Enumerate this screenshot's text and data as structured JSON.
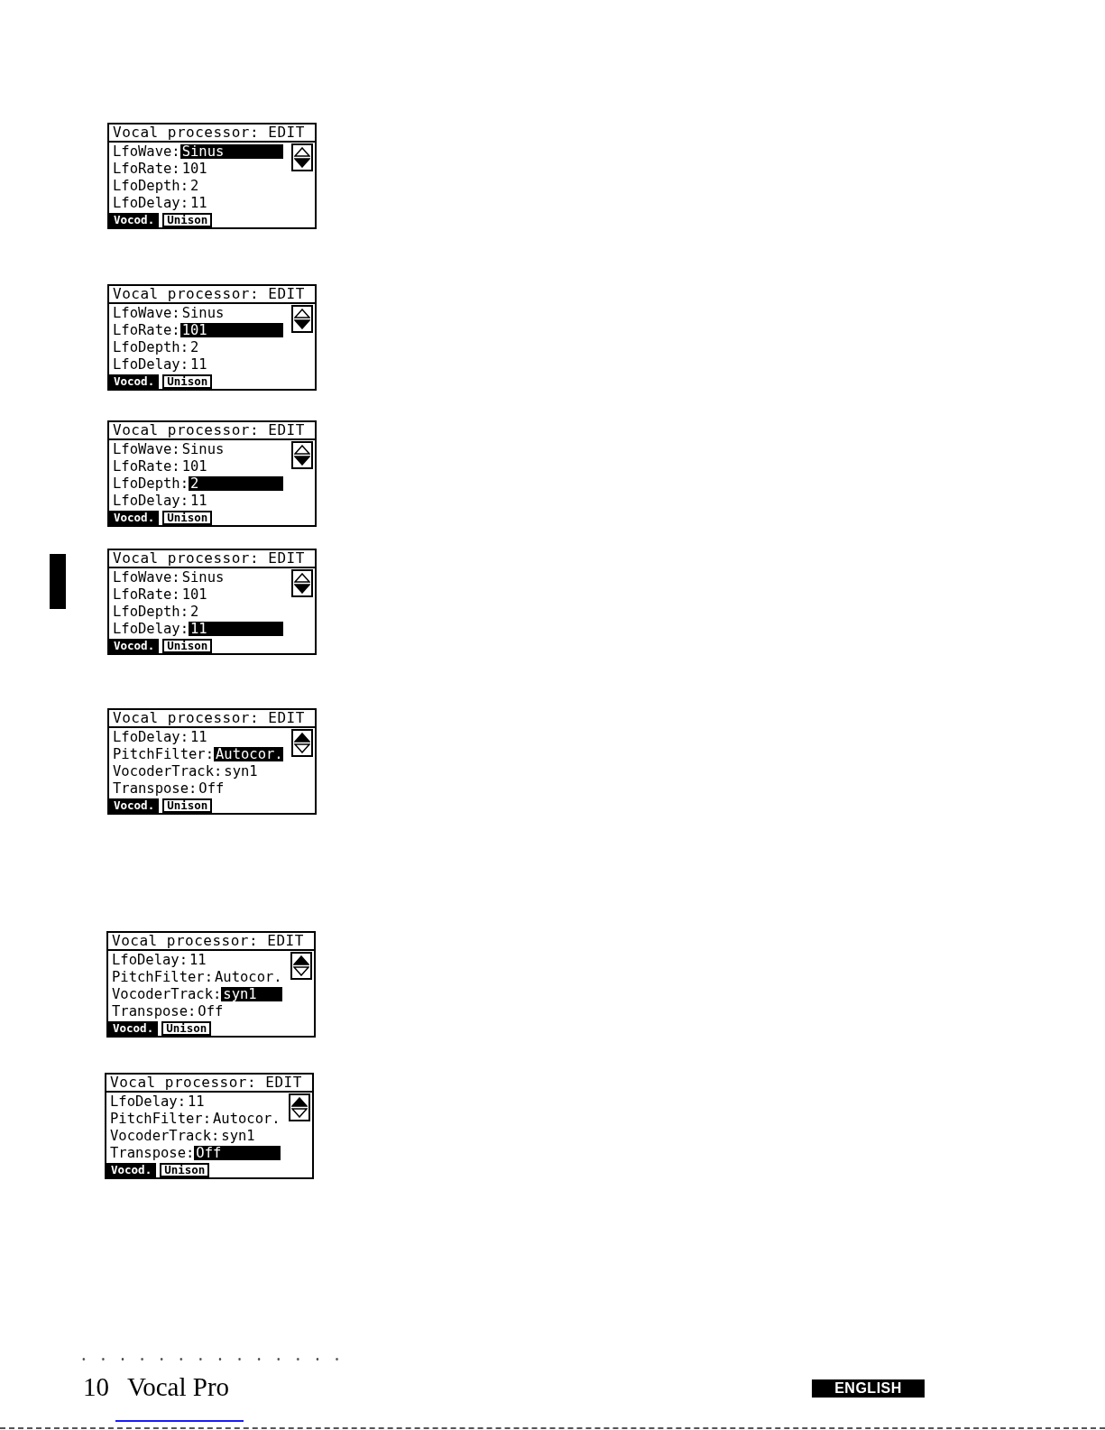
{
  "screens": [
    {
      "title": "Vocal processor: EDIT",
      "rows": [
        {
          "label": "LfoWave:",
          "value": "Sinus",
          "selected": true
        },
        {
          "label": "LfoRate:",
          "value": "101",
          "selected": false
        },
        {
          "label": "LfoDepth:",
          "value": "2",
          "selected": false
        },
        {
          "label": "LfoDelay:",
          "value": "11",
          "selected": false
        }
      ],
      "more_above": false,
      "more_below": true,
      "tabs": [
        {
          "label": "Vocod.",
          "selected": true
        },
        {
          "label": "Unison",
          "selected": false
        }
      ]
    },
    {
      "title": "Vocal processor: EDIT",
      "rows": [
        {
          "label": "LfoWave:",
          "value": "Sinus",
          "selected": false
        },
        {
          "label": "LfoRate:",
          "value": "101",
          "selected": true
        },
        {
          "label": "LfoDepth:",
          "value": "2",
          "selected": false
        },
        {
          "label": "LfoDelay:",
          "value": "11",
          "selected": false
        }
      ],
      "more_above": false,
      "more_below": true,
      "tabs": [
        {
          "label": "Vocod.",
          "selected": true
        },
        {
          "label": "Unison",
          "selected": false
        }
      ]
    },
    {
      "title": "Vocal processor: EDIT",
      "rows": [
        {
          "label": "LfoWave:",
          "value": "Sinus",
          "selected": false
        },
        {
          "label": "LfoRate:",
          "value": "101",
          "selected": false
        },
        {
          "label": "LfoDepth:",
          "value": "2",
          "selected": true
        },
        {
          "label": "LfoDelay:",
          "value": "11",
          "selected": false
        }
      ],
      "more_above": false,
      "more_below": true,
      "tabs": [
        {
          "label": "Vocod.",
          "selected": true
        },
        {
          "label": "Unison",
          "selected": false
        }
      ]
    },
    {
      "title": "Vocal processor: EDIT",
      "rows": [
        {
          "label": "LfoWave:",
          "value": "Sinus",
          "selected": false
        },
        {
          "label": "LfoRate:",
          "value": "101",
          "selected": false
        },
        {
          "label": "LfoDepth:",
          "value": "2",
          "selected": false
        },
        {
          "label": "LfoDelay:",
          "value": "11",
          "selected": true
        }
      ],
      "more_above": false,
      "more_below": true,
      "tabs": [
        {
          "label": "Vocod.",
          "selected": true
        },
        {
          "label": "Unison",
          "selected": false
        }
      ]
    },
    {
      "title": "Vocal processor: EDIT",
      "rows": [
        {
          "label": "LfoDelay:",
          "value": "11",
          "selected": false
        },
        {
          "label": "PitchFilter:",
          "value": "Autocor.",
          "selected": true
        },
        {
          "label": "VocoderTrack:",
          "value": "syn1",
          "selected": false
        },
        {
          "label": "Transpose:",
          "value": "Off",
          "selected": false
        }
      ],
      "more_above": true,
      "more_below": false,
      "tabs": [
        {
          "label": "Vocod.",
          "selected": true
        },
        {
          "label": "Unison",
          "selected": false
        }
      ]
    },
    {
      "title": "Vocal processor: EDIT",
      "rows": [
        {
          "label": "LfoDelay:",
          "value": "11",
          "selected": false
        },
        {
          "label": "PitchFilter:",
          "value": "Autocor.",
          "selected": false
        },
        {
          "label": "VocoderTrack:",
          "value": "syn1",
          "selected": true
        },
        {
          "label": "Transpose:",
          "value": "Off",
          "selected": false
        }
      ],
      "more_above": true,
      "more_below": false,
      "tabs": [
        {
          "label": "Vocod.",
          "selected": true
        },
        {
          "label": "Unison",
          "selected": false
        }
      ]
    },
    {
      "title": "Vocal processor: EDIT",
      "rows": [
        {
          "label": "LfoDelay:",
          "value": "11",
          "selected": false
        },
        {
          "label": "PitchFilter:",
          "value": "Autocor.",
          "selected": false
        },
        {
          "label": "VocoderTrack:",
          "value": "syn1",
          "selected": false
        },
        {
          "label": "Transpose:",
          "value": "Off",
          "selected": true
        }
      ],
      "more_above": true,
      "more_below": false,
      "tabs": [
        {
          "label": "Vocod.",
          "selected": true
        },
        {
          "label": "Unison",
          "selected": false
        }
      ]
    }
  ],
  "footer": {
    "page_number": "10",
    "title": "Vocal Pro",
    "language": "ENGLISH"
  }
}
